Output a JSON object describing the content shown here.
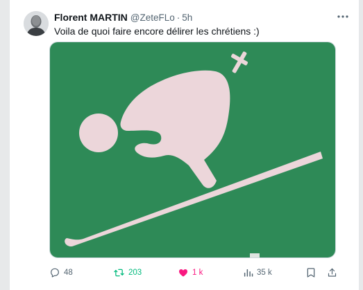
{
  "tweet": {
    "author_name": "Florent MARTIN",
    "handle": "@ZeteFLo",
    "separator": "·",
    "time": "5h",
    "text": "Voila de quoi faire encore délirer les chrétiens :)",
    "more_icon": "more-horizontal-icon"
  },
  "media": {
    "background_color": "#2e8a57",
    "figure_color": "#ecd6da",
    "icons": [
      "ski-pictogram",
      "cross"
    ]
  },
  "actions": {
    "replies": "48",
    "reposts": "203",
    "likes": "1 k",
    "views": "35 k",
    "reply_icon": "reply-icon",
    "repost_icon": "repost-icon",
    "like_icon": "heart-icon",
    "views_icon": "views-icon",
    "bookmark_icon": "bookmark-icon",
    "share_icon": "share-icon",
    "repost_color": "#00ba7c",
    "like_color": "#f91880"
  }
}
